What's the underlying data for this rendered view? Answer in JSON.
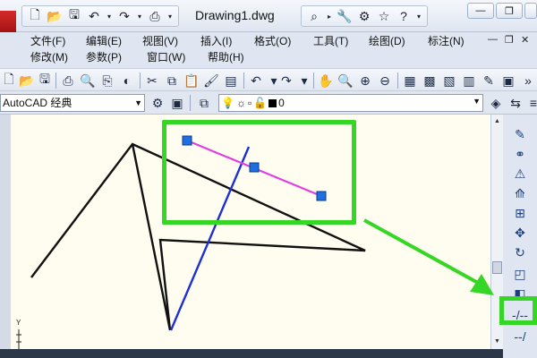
{
  "window": {
    "document_title": "Drawing1.dwg",
    "controls": {
      "minimize": "—",
      "restore": "❐",
      "close": "✕"
    }
  },
  "quick_access": [
    "new-icon",
    "open-icon",
    "save-icon",
    "undo-icon",
    "redo-icon",
    "plot-icon"
  ],
  "infocenter": [
    "binoculars-icon",
    "wrench-icon",
    "star-icon",
    "help-icon"
  ],
  "menubar": {
    "row1": [
      "文件(F)",
      "编辑(E)",
      "视图(V)",
      "插入(I)",
      "格式(O)",
      "工具(T)",
      "绘图(D)",
      "标注(N)"
    ],
    "row2": [
      "修改(M)",
      "参数(P)",
      "窗口(W)",
      "帮助(H)"
    ]
  },
  "workspace": {
    "selected": "AutoCAD 经典"
  },
  "layer": {
    "current": "0"
  },
  "canvas": {
    "background": "#fffdf0",
    "ucs_label": "Y"
  },
  "colors": {
    "annotation_green": "#35d625",
    "selected_line": "#e040e0",
    "grip": "#1e6fe0",
    "blue_line": "#1d2fd6"
  }
}
